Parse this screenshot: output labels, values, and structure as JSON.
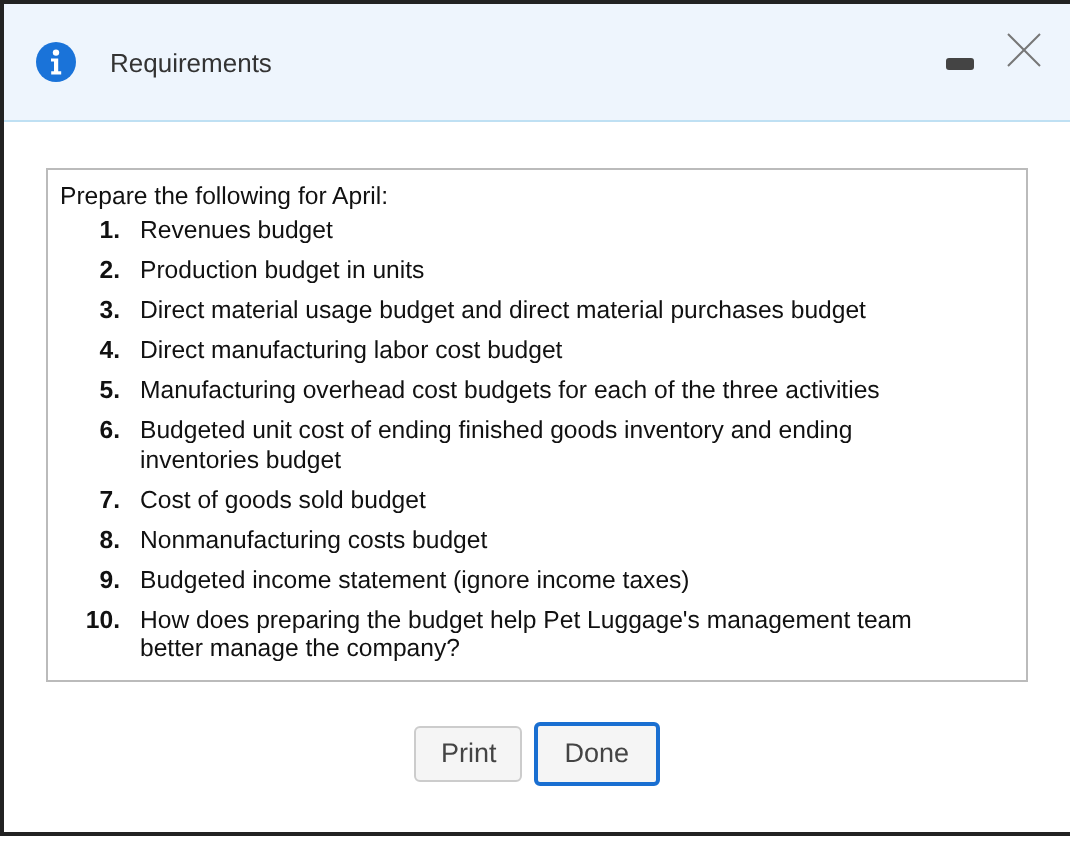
{
  "window": {
    "title": "Requirements"
  },
  "intro": "Prepare the following for April:",
  "items": [
    {
      "number": "1.",
      "text": "Revenues budget"
    },
    {
      "number": "2.",
      "text": "Production budget in units"
    },
    {
      "number": "3.",
      "text": "Direct material usage budget and direct material purchases budget"
    },
    {
      "number": "4.",
      "text": "Direct manufacturing labor cost budget"
    },
    {
      "number": "5.",
      "text": "Manufacturing overhead cost budgets for each of the three activities"
    },
    {
      "number": "6.",
      "text": "Budgeted unit cost of ending finished goods inventory and ending inventories budget"
    },
    {
      "number": "7.",
      "text": "Cost of goods sold budget"
    },
    {
      "number": "8.",
      "text": "Nonmanufacturing costs budget"
    },
    {
      "number": "9.",
      "text": "Budgeted income statement (ignore income taxes)"
    },
    {
      "number": "10.",
      "text": "How does preparing the budget help Pet Luggage's management team better manage the company?"
    }
  ],
  "buttons": [
    {
      "label": "Print",
      "focused": false
    },
    {
      "label": "Done",
      "focused": true
    }
  ]
}
